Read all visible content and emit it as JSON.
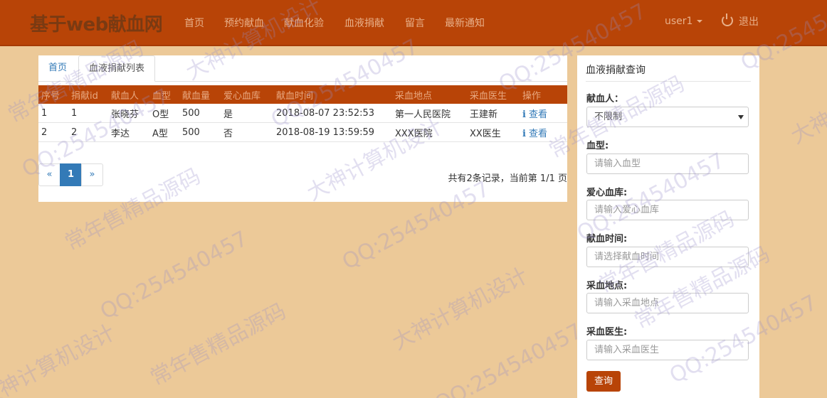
{
  "navbar": {
    "brand": "基于web献血网",
    "links": [
      "首页",
      "预约献血",
      "献血化验",
      "血液捐献",
      "留言",
      "最新通知"
    ],
    "user": "user1",
    "logout": "退出"
  },
  "tabs": {
    "home": "首页",
    "active": "血液捐献列表"
  },
  "table": {
    "headers": [
      "序号",
      "捐献id",
      "献血人",
      "血型",
      "献血量",
      "爱心血库",
      "献血时间",
      "采血地点",
      "采血医生",
      "操作"
    ],
    "rows": [
      [
        "1",
        "1",
        "张晓芬",
        "O型",
        "500",
        "是",
        "2018-08-07 23:52:53",
        "第一人民医院",
        "王建新",
        "查看"
      ],
      [
        "2",
        "2",
        "李达",
        "A型",
        "500",
        "否",
        "2018-08-19 13:59:59",
        "XXX医院",
        "XX医生",
        "查看"
      ]
    ]
  },
  "pager": {
    "prev": "«",
    "current": "1",
    "next": "»"
  },
  "record_info": "共有2条记录，当前第 1/1 页",
  "search": {
    "title": "血液捐献查询",
    "donor_label": "献血人：",
    "donor_value": "不限制",
    "blood_type_label": "血型:",
    "blood_type_placeholder": "请输入血型",
    "bank_label": "爱心血库:",
    "bank_placeholder": "请输入爱心血库",
    "time_label": "献血时间:",
    "time_placeholder": "请选择献血时间",
    "place_label": "采血地点:",
    "place_placeholder": "请输入采血地点",
    "doctor_label": "采血医生:",
    "doctor_placeholder": "请输入采血医生",
    "query_button": "查询"
  },
  "watermark": [
    "QQ:254540457",
    "常年售精品源码",
    "大神计算机设计"
  ],
  "colors": {
    "navbar": "#b84407",
    "background": "#ecc998",
    "link": "#337ab7"
  }
}
